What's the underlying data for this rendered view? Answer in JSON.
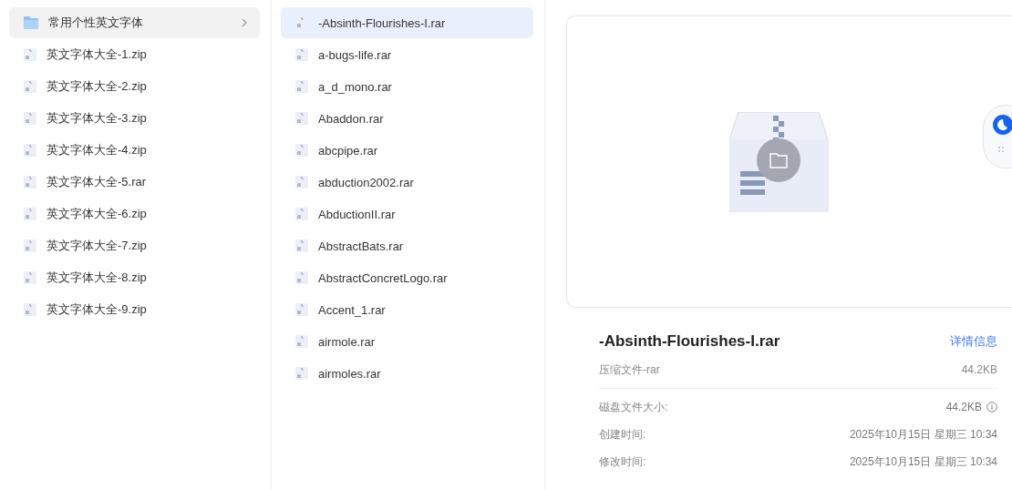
{
  "columns": [
    {
      "items": [
        {
          "name": "常用个性英文字体",
          "kind": "folder",
          "selected": true,
          "color": "#f2f2f2"
        },
        {
          "name": "英文字体大全-1.zip",
          "kind": "archive",
          "selected": false
        },
        {
          "name": "英文字体大全-2.zip",
          "kind": "archive",
          "selected": false
        },
        {
          "name": "英文字体大全-3.zip",
          "kind": "archive",
          "selected": false
        },
        {
          "name": "英文字体大全-4.zip",
          "kind": "archive",
          "selected": false
        },
        {
          "name": "英文字体大全-5.rar",
          "kind": "archive",
          "selected": false
        },
        {
          "name": "英文字体大全-6.zip",
          "kind": "archive",
          "selected": false
        },
        {
          "name": "英文字体大全-7.zip",
          "kind": "archive",
          "selected": false
        },
        {
          "name": "英文字体大全-8.zip",
          "kind": "archive",
          "selected": false
        },
        {
          "name": "英文字体大全-9.zip",
          "kind": "archive",
          "selected": false
        }
      ]
    },
    {
      "items": [
        {
          "name": "-Absinth-Flourishes-I.rar",
          "kind": "archive",
          "selected": true,
          "color": "#e9f0fd"
        },
        {
          "name": "a-bugs-life.rar",
          "kind": "archive",
          "selected": false
        },
        {
          "name": "a_d_mono.rar",
          "kind": "archive",
          "selected": false
        },
        {
          "name": "Abaddon.rar",
          "kind": "archive",
          "selected": false
        },
        {
          "name": "abcpipe.rar",
          "kind": "archive",
          "selected": false
        },
        {
          "name": "abduction2002.rar",
          "kind": "archive",
          "selected": false
        },
        {
          "name": "AbductionII.rar",
          "kind": "archive",
          "selected": false
        },
        {
          "name": "AbstractBats.rar",
          "kind": "archive",
          "selected": false
        },
        {
          "name": "AbstractConcretLogo.rar",
          "kind": "archive",
          "selected": false
        },
        {
          "name": "Accent_1.rar",
          "kind": "archive",
          "selected": false
        },
        {
          "name": "airmole.rar",
          "kind": "archive",
          "selected": false
        },
        {
          "name": "airmoles.rar",
          "kind": "archive",
          "selected": false
        }
      ]
    }
  ],
  "details": {
    "title": "-Absinth-Flourishes-I.rar",
    "link": "详情信息",
    "type": "压缩文件-rar",
    "size": "44.2KB",
    "fields": [
      {
        "label": "磁盘文件大小:",
        "value": "44.2KB",
        "info": true
      },
      {
        "label": "创建时间:",
        "value": "2025年10月15日 星期三 10:34",
        "info": false
      },
      {
        "label": "修改时间:",
        "value": "2025年10月15日 星期三 10:34",
        "info": false
      }
    ]
  }
}
